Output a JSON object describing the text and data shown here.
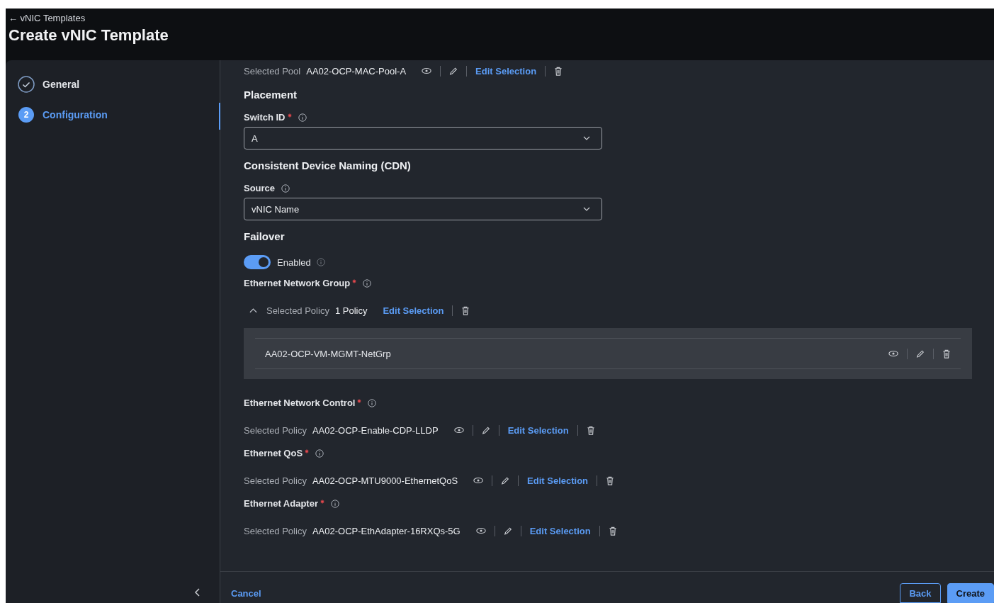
{
  "header": {
    "back_link": "← vNIC Templates",
    "title": "Create vNIC Template"
  },
  "steps": [
    {
      "label": "General",
      "kind": "done",
      "selected": false
    },
    {
      "label": "Configuration",
      "number": "2",
      "kind": "current",
      "selected": true
    }
  ],
  "form": [
    {
      "kind": "policy",
      "label": "Selected Pool",
      "value": "AA02-OCP-MAC-Pool-A",
      "action": "Edit Selection"
    },
    {
      "kind": "heading",
      "text": "Placement"
    },
    {
      "kind": "select",
      "label": "Switch ID",
      "required": true,
      "value": "A"
    },
    {
      "kind": "heading",
      "text": "Consistent Device Naming (CDN)"
    },
    {
      "kind": "select",
      "label": "Source",
      "required": false,
      "value": "vNIC Name"
    },
    {
      "kind": "heading",
      "text": "Failover"
    },
    {
      "kind": "toggle",
      "label": "Enabled",
      "on": true
    },
    {
      "kind": "field-label",
      "label": "Ethernet Network Group",
      "required": true
    },
    {
      "kind": "group",
      "label": "Selected Policy",
      "value": "1 Policy",
      "action": "Edit Selection",
      "expanded": true,
      "items": [
        "AA02-OCP-VM-MGMT-NetGrp"
      ]
    },
    {
      "kind": "field-label",
      "label": "Ethernet Network Control",
      "required": true
    },
    {
      "kind": "policy",
      "label": "Selected Policy",
      "value": "AA02-OCP-Enable-CDP-LLDP",
      "action": "Edit Selection"
    },
    {
      "kind": "field-label",
      "label": "Ethernet QoS",
      "required": true
    },
    {
      "kind": "policy",
      "label": "Selected Policy",
      "value": "AA02-OCP-MTU9000-EthernetQoS",
      "action": "Edit Selection"
    },
    {
      "kind": "field-label",
      "label": "Ethernet Adapter",
      "required": true
    },
    {
      "kind": "policy",
      "label": "Selected Policy",
      "value": "AA02-OCP-EthAdapter-16RXQs-5G",
      "action": "Edit Selection"
    }
  ],
  "footer": {
    "cancel": "Cancel",
    "back": "Back",
    "create": "Create"
  }
}
